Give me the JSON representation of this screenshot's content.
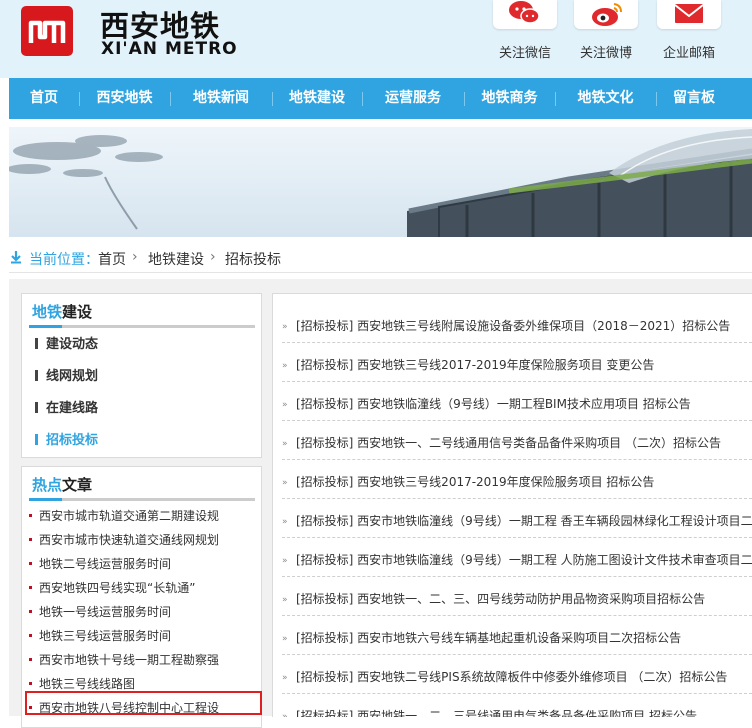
{
  "header": {
    "logo_cn": "西安地铁",
    "logo_en": "XI'AN METRO",
    "links": [
      {
        "label": "关注微信",
        "icon": "wechat-icon"
      },
      {
        "label": "关注微博",
        "icon": "weibo-icon"
      },
      {
        "label": "企业邮箱",
        "icon": "mail-icon"
      }
    ]
  },
  "nav": {
    "items": [
      "首页",
      "西安地铁",
      "地铁新闻",
      "地铁建设",
      "运营服务",
      "地铁商务",
      "地铁文化",
      "留言板"
    ]
  },
  "breadcrumb": {
    "label": "当前位置：",
    "items": [
      "首页",
      "地铁建设",
      "招标投标"
    ],
    "separator": "›"
  },
  "category": {
    "title_hl": "地铁",
    "title_rest": "建设",
    "items": [
      "建设动态",
      "线网规划",
      "在建线路",
      "招标投标"
    ],
    "active_index": 3
  },
  "hot": {
    "title_hl": "热点",
    "title_rest": "文章",
    "items": [
      "西安市城市轨道交通第二期建设规",
      "西安市城市快速轨道交通线网规划",
      "地铁二号线运营服务时间",
      "西安地铁四号线实现“长轨通”",
      "地铁一号线运营服务时间",
      "地铁三号线运营服务时间",
      "西安市地铁十号线一期工程勘察强",
      "地铁三号线线路图",
      "西安市地铁八号线控制中心工程设"
    ]
  },
  "list": {
    "items": [
      "[招标投标] 西安地铁三号线附属设施设备委外维保项目（2018－2021）招标公告",
      "[招标投标] 西安地铁三号线2017-2019年度保险服务项目 变更公告",
      "[招标投标] 西安地铁临潼线（9号线）一期工程BIM技术应用项目 招标公告",
      "[招标投标] 西安地铁一、二号线通用信号类备品备件采购项目 （二次）招标公告",
      "[招标投标] 西安地铁三号线2017-2019年度保险服务项目 招标公告",
      "[招标投标] 西安市地铁临潼线（9号线）一期工程 香王车辆段园林绿化工程设计项目二",
      "[招标投标] 西安市地铁临潼线（9号线）一期工程 人防施工图设计文件技术审查项目二",
      "[招标投标] 西安地铁一、二、三、四号线劳动防护用品物资采购项目招标公告",
      "[招标投标] 西安市地铁六号线车辆基地起重机设备采购项目二次招标公告",
      "[招标投标] 西安地铁二号线PIS系统故障板件中修委外维修项目 （二次）招标公告",
      "[招标投标] 西安地铁一、二、三号线通用电气类备品备件采购项目 招标公告"
    ]
  },
  "colors": {
    "brand_red": "#d7181d",
    "nav_blue": "#2fa4e0",
    "hot_highlight": "#e02020"
  }
}
